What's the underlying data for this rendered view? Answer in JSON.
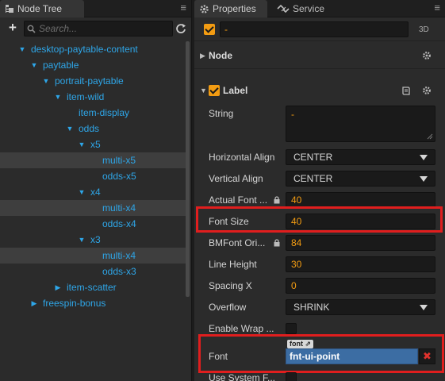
{
  "node_tree": {
    "tab_title": "Node Tree",
    "search_placeholder": "Search...",
    "items": [
      {
        "label": "desktop-paytable-content",
        "depth": 0,
        "expanded": true,
        "has_children": true,
        "selected": false
      },
      {
        "label": "paytable",
        "depth": 1,
        "expanded": true,
        "has_children": true,
        "selected": false
      },
      {
        "label": "portrait-paytable",
        "depth": 2,
        "expanded": true,
        "has_children": true,
        "selected": false
      },
      {
        "label": "item-wild",
        "depth": 3,
        "expanded": true,
        "has_children": true,
        "selected": false
      },
      {
        "label": "item-display",
        "depth": 4,
        "expanded": false,
        "has_children": false,
        "selected": false
      },
      {
        "label": "odds",
        "depth": 4,
        "expanded": true,
        "has_children": true,
        "selected": false
      },
      {
        "label": "x5",
        "depth": 5,
        "expanded": true,
        "has_children": true,
        "selected": false
      },
      {
        "label": "multi-x5",
        "depth": 6,
        "expanded": false,
        "has_children": false,
        "selected": true
      },
      {
        "label": "odds-x5",
        "depth": 6,
        "expanded": false,
        "has_children": false,
        "selected": false
      },
      {
        "label": "x4",
        "depth": 5,
        "expanded": true,
        "has_children": true,
        "selected": false
      },
      {
        "label": "multi-x4",
        "depth": 6,
        "expanded": false,
        "has_children": false,
        "selected": true
      },
      {
        "label": "odds-x4",
        "depth": 6,
        "expanded": false,
        "has_children": false,
        "selected": false
      },
      {
        "label": "x3",
        "depth": 5,
        "expanded": true,
        "has_children": true,
        "selected": false
      },
      {
        "label": "multi-x4",
        "depth": 6,
        "expanded": false,
        "has_children": false,
        "selected": true
      },
      {
        "label": "odds-x3",
        "depth": 6,
        "expanded": false,
        "has_children": false,
        "selected": false
      },
      {
        "label": "item-scatter",
        "depth": 3,
        "expanded": false,
        "has_children": true,
        "selected": false
      },
      {
        "label": "freespin-bonus",
        "depth": 1,
        "expanded": false,
        "has_children": true,
        "selected": false
      }
    ]
  },
  "properties": {
    "tab_title": "Properties",
    "service_tab_title": "Service",
    "node_name": "-",
    "badge_3d": "3D",
    "node_section": "Node",
    "label_section": "Label",
    "fields": {
      "string_label": "String",
      "string_value": "-",
      "h_align_label": "Horizontal Align",
      "h_align_value": "CENTER",
      "v_align_label": "Vertical Align",
      "v_align_value": "CENTER",
      "actual_font_label": "Actual Font ...",
      "actual_font_value": "40",
      "font_size_label": "Font Size",
      "font_size_value": "40",
      "bmfont_label": "BMFont Ori...",
      "bmfont_value": "84",
      "line_height_label": "Line Height",
      "line_height_value": "30",
      "spacing_x_label": "Spacing X",
      "spacing_x_value": "0",
      "overflow_label": "Overflow",
      "overflow_value": "SHRINK",
      "enable_wrap_label": "Enable Wrap ...",
      "font_label": "Font",
      "font_type_tag": "font",
      "font_value": "fnt-ui-point",
      "font_clear": "✖",
      "use_system_font_label": "Use System F..."
    }
  },
  "colors": {
    "accent": "#f39c12",
    "tree_text": "#2ea6e8",
    "highlight": "#e01e1e",
    "asset_field": "#3c6da3"
  }
}
